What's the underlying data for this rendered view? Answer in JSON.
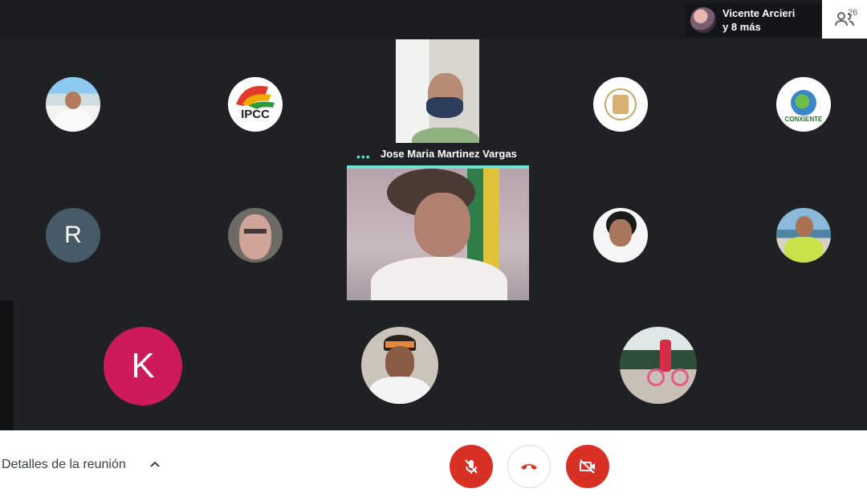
{
  "presenter_chip": {
    "name": "Vicente Arcieri",
    "more": "y 8 más"
  },
  "people": {
    "count": "26",
    "icon": "people-icon"
  },
  "participants": {
    "r_initial": "R",
    "k_initial": "K",
    "logo_ipcc_text": "IPCC",
    "logo_conxiente_text": "CONXIENTE"
  },
  "active_speaker": {
    "name": "Jose Maria Martinez Vargas",
    "indicator": "•••"
  },
  "bottom": {
    "details_label": "Detalles de la reunión",
    "mic_icon": "mic-off-icon",
    "hangup_icon": "hang-up-icon",
    "camera_icon": "camera-off-icon"
  },
  "colors": {
    "red": "#d93025",
    "accent": "#6fe3d3",
    "k_avatar": "#cc1a5b",
    "r_avatar": "#465a68"
  }
}
